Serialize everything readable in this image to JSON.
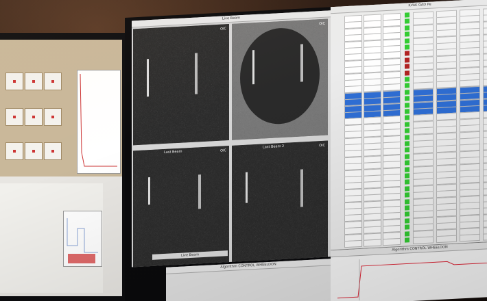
{
  "left_monitor": {},
  "main_monitor": {
    "camera_window_title": "Live Beam",
    "cameras": [
      {
        "title": "Live Beam",
        "badge": "OIC"
      },
      {
        "title": "",
        "badge": "OIC"
      },
      {
        "title": "Last Beam",
        "badge": "OIC"
      },
      {
        "title": "Last Beam 2",
        "badge": "OIC"
      }
    ],
    "table_title": "KVAK GAD Pe",
    "plot_title": "Algorithm CONTROL WHEELDON",
    "plot2_title": "Algorithm CONTROL WHEELDON",
    "status_bar": "Live Beam"
  },
  "colors": {
    "red": "#b22222",
    "green": "#33cc33",
    "blue": "#2f6fd6"
  }
}
